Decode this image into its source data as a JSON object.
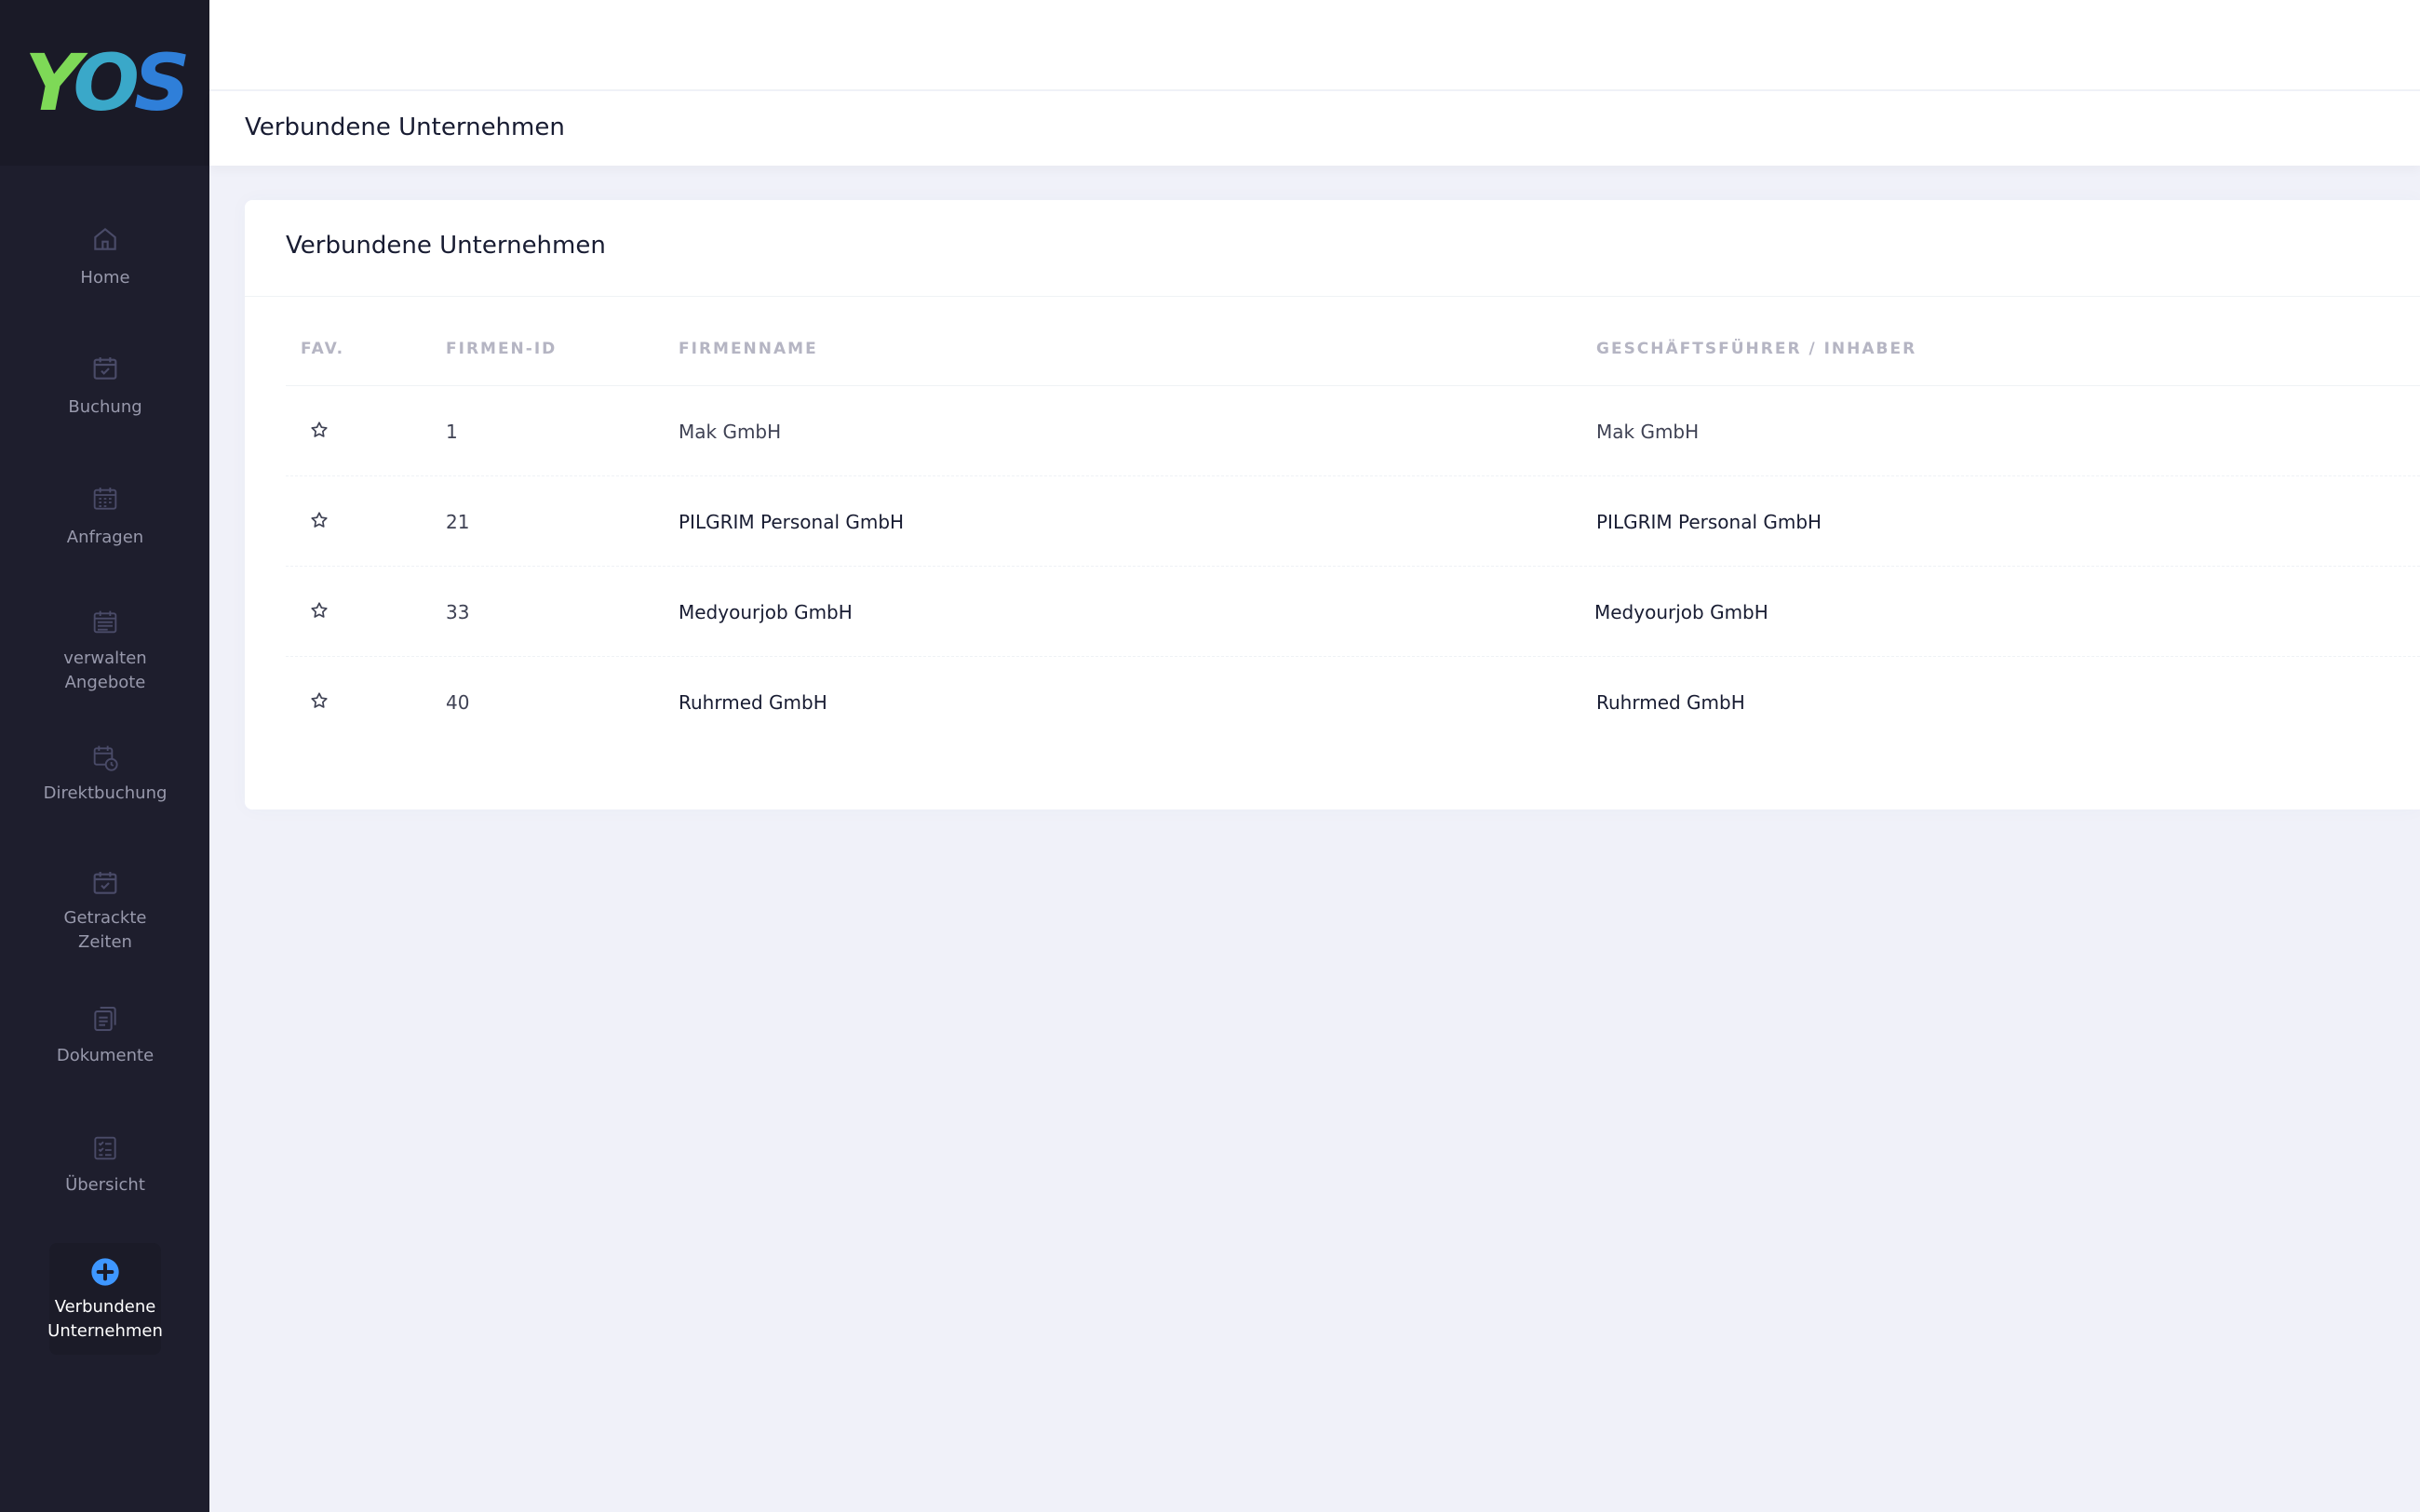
{
  "logo": {
    "y": "Y",
    "o": "O",
    "s": "S"
  },
  "sidebar": {
    "items": [
      {
        "label": "Home",
        "icon": "home-icon"
      },
      {
        "label": "Buchung",
        "icon": "calendar-check-icon"
      },
      {
        "label": "Anfragen",
        "icon": "calendar-grid-icon"
      },
      {
        "label": "verwalten Angebote",
        "icon": "calendar-list-icon"
      },
      {
        "label": "Direktbuchung",
        "icon": "calendar-clock-icon"
      },
      {
        "label": "Getrackte Zeiten",
        "icon": "calendar-check-icon"
      },
      {
        "label": "Dokumente",
        "icon": "documents-icon"
      },
      {
        "label": "Übersicht",
        "icon": "checklist-icon"
      },
      {
        "label": "Verbundene Unternehmen",
        "icon": "plus-circle-icon"
      }
    ]
  },
  "header": {
    "title": "Verbundene Unternehmen"
  },
  "card": {
    "title": "Verbundene Unternehmen",
    "columns": [
      "FAV.",
      "FIRMEN-ID",
      "FIRMENNAME",
      "GESCHÄFTSFÜHRER / INHABER"
    ],
    "rows": [
      {
        "id": "1",
        "name": "Mak GmbH",
        "owner": "Mak GmbH"
      },
      {
        "id": "21",
        "name": "PILGRIM Personal GmbH",
        "owner": "PILGRIM Personal GmbH"
      },
      {
        "id": "33",
        "name": "Medyourjob GmbH",
        "owner": "Medyourjob GmbH"
      },
      {
        "id": "40",
        "name": "Ruhrmed GmbH",
        "owner": "Ruhrmed GmbH"
      }
    ]
  },
  "colors": {
    "sidebar": "#1e1e2d",
    "active_icon": "#3e97ff",
    "background": "#f0f1f9"
  }
}
